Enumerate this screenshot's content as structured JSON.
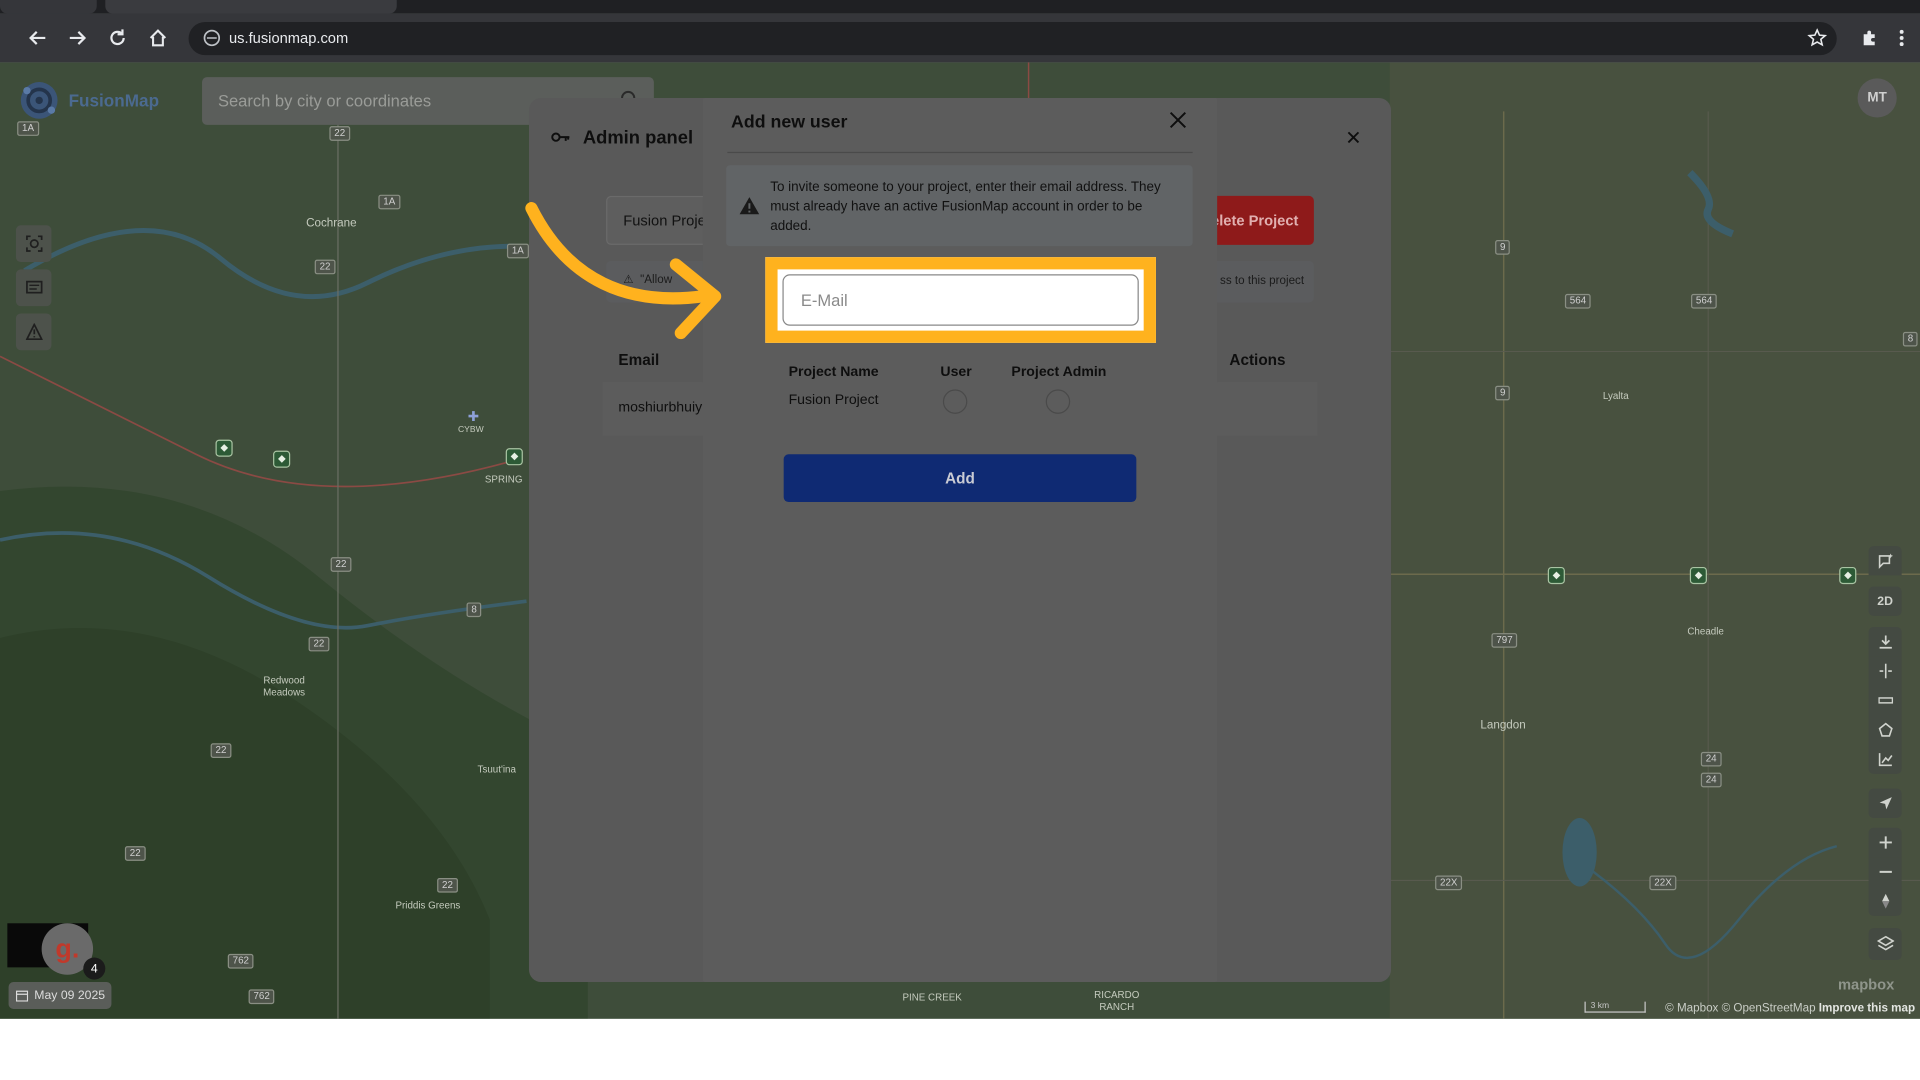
{
  "browser": {
    "url": "us.fusionmap.com"
  },
  "app": {
    "name": "FusionMap",
    "search_placeholder": "Search by city or coordinates",
    "avatar_initials": "MT",
    "date_label": "May 09 2025",
    "notification_count": "4",
    "g_label": "g.",
    "view_mode": "2D",
    "attribution_mapbox": "© Mapbox",
    "attribution_osm": "© OpenStreetMap",
    "attribution_improve": "Improve this map",
    "scale_label": "3 km",
    "mapbox_logo": "mapbox"
  },
  "map": {
    "labels": [
      "Cochrane",
      "CYBW",
      "SPRING",
      "Redwood Meadows",
      "Tsuut'ina",
      "Priddis Greens",
      "PINE CREEK",
      "RICARDO RANCH",
      "Lyalta",
      "Cheadle",
      "Langdon"
    ],
    "shields": [
      "1A",
      "22",
      "1A",
      "22",
      "1A",
      "22",
      "8",
      "22",
      "22",
      "22",
      "22",
      "762",
      "762",
      "9",
      "564",
      "564",
      "9",
      "797",
      "24",
      "24",
      "22X",
      "22X",
      "8"
    ]
  },
  "admin_panel": {
    "title": "Admin panel",
    "project_select": "Fusion Proje",
    "delete_button": "elete Project",
    "note_left": "\"Allow",
    "note_right": "ss to this project",
    "col_email": "Email",
    "col_actions": "Actions",
    "row_email": "moshiurbhuiy"
  },
  "modal": {
    "title": "Add new user",
    "info": "To invite someone to your project, enter their email address. They must already have an active FusionMap account in order to be added.",
    "email_placeholder": "E-Mail",
    "col_project_name": "Project Name",
    "col_user": "User",
    "col_project_admin": "Project Admin",
    "project_name": "Fusion Project",
    "add_button": "Add"
  },
  "colors": {
    "highlight": "#ffb21e",
    "add_button": "#0f2a73",
    "delete_button": "#8e1a1a"
  }
}
